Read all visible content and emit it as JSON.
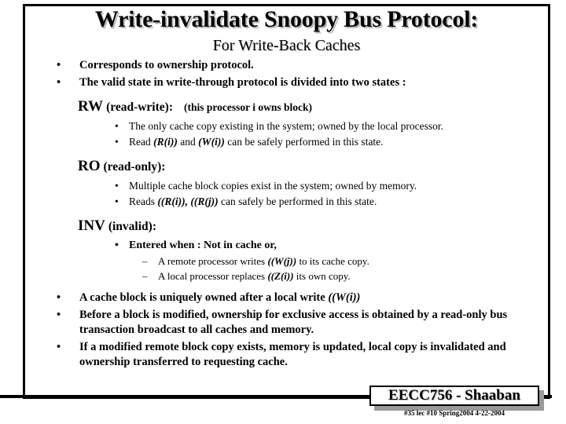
{
  "slide": {
    "title": "Write-invalidate Snoopy Bus Protocol:",
    "subtitle": "For Write-Back Caches",
    "top_bullets": [
      {
        "marker": "•",
        "text": "Corresponds to ownership protocol."
      },
      {
        "marker": "•",
        "text": "The valid state in write-through protocol is divided into two states :"
      }
    ],
    "states": [
      {
        "tag": "RW",
        "paren": "(read-write):",
        "note": "(this processor i owns block)",
        "points": [
          {
            "marker": "•",
            "pre": "The only cache copy existing in the system; owned by the local processor.",
            "ital": "",
            "post": ""
          },
          {
            "marker": "•",
            "pre": "Read ",
            "ital": "(R(i))",
            "mid": " and ",
            "ital2": "(W(i))",
            "post": " can be safely performed in this state."
          }
        ]
      },
      {
        "tag": "RO",
        "paren": "(read-only):",
        "note": "",
        "points": [
          {
            "marker": "•",
            "pre": "Multiple cache block copies exist in the system; owned by memory.",
            "ital": "",
            "post": ""
          },
          {
            "marker": "•",
            "pre": "Reads ",
            "ital": "((R(i)),",
            "mid": "  ",
            "ital2": "((R(j))",
            "post": " can safely be performed in this state."
          }
        ]
      },
      {
        "tag": "INV",
        "paren": "(invalid):",
        "note": "",
        "entered_bullet": {
          "marker": "•",
          "text": "Entered when :   Not in cache or,"
        },
        "dashes": [
          {
            "marker": "–",
            "pre": "A remote processor writes  ",
            "ital": "((W(j))",
            "post": "  to its cache copy."
          },
          {
            "marker": "–",
            "pre": "A local processor replaces ",
            "ital": "((Z(i))",
            "post": " its own copy."
          }
        ]
      }
    ],
    "bottom_bullets": [
      {
        "marker": "•",
        "pre": "A cache block is uniquely owned after a local write ",
        "ital": "((W(i))",
        "post": ""
      },
      {
        "marker": "•",
        "pre": "Before a block is modified, ownership for exclusive access is obtained by a read-only bus transaction broadcast to all caches and memory.",
        "ital": "",
        "post": ""
      },
      {
        "marker": "•",
        "pre": "If a modified remote block copy exists, memory is updated, local copy is invalidated and ownership transferred to requesting cache.",
        "ital": "",
        "post": ""
      }
    ]
  },
  "footer": {
    "course": "EECC756 - Shaaban",
    "meta": "#35   lec #10    Spring2004   4-22-2004"
  },
  "colors": {
    "text": "#000000",
    "shadow": "#b9b9b9",
    "box_shadow": "#9a9a9a",
    "background": "#ffffff"
  }
}
